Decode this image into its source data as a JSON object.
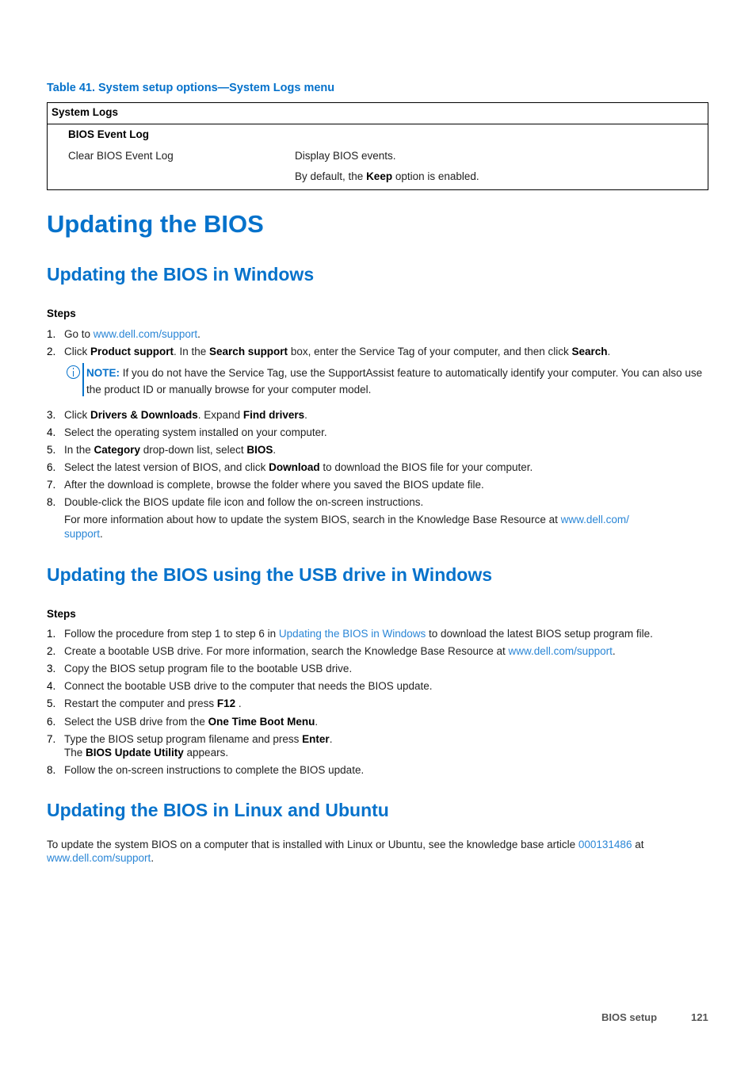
{
  "table": {
    "caption": "Table 41. System setup options—System Logs menu",
    "header": "System Logs",
    "subheader": "BIOS Event Log",
    "option": "Clear BIOS Event Log",
    "desc1": "Display BIOS events.",
    "desc2_pre": "By default, the ",
    "desc2_bold": "Keep",
    "desc2_post": " option is enabled."
  },
  "title": "Updating the BIOS",
  "sec1": {
    "heading": "Updating the BIOS in Windows",
    "steps_label": "Steps",
    "s1": {
      "num": "1.",
      "pre": "Go to ",
      "link": "www.dell.com/support",
      "post": "."
    },
    "s2": {
      "num": "2.",
      "t1": "Click ",
      "b1": "Product support",
      "t2": ". In the ",
      "b2": "Search support",
      "t3": " box, enter the Service Tag of your computer, and then click ",
      "b3": "Search",
      "t4": "."
    },
    "note": {
      "label": "NOTE:",
      "text": " If you do not have the Service Tag, use the SupportAssist feature to automatically identify your computer. You can also use the product ID or manually browse for your computer model."
    },
    "s3": {
      "num": "3.",
      "t1": "Click ",
      "b1": "Drivers & Downloads",
      "t2": ". Expand ",
      "b2": "Find drivers",
      "t3": "."
    },
    "s4": {
      "num": "4.",
      "text": "Select the operating system installed on your computer."
    },
    "s5": {
      "num": "5.",
      "t1": "In the ",
      "b1": "Category",
      "t2": " drop-down list, select ",
      "b2": "BIOS",
      "t3": "."
    },
    "s6": {
      "num": "6.",
      "t1": "Select the latest version of BIOS, and click ",
      "b1": "Download",
      "t2": " to download the BIOS file for your computer."
    },
    "s7": {
      "num": "7.",
      "text": "After the download is complete, browse the folder where you saved the BIOS update file."
    },
    "s8": {
      "num": "8.",
      "text": "Double-click the BIOS update file icon and follow the on-screen instructions."
    },
    "more": {
      "pre": "For more information about how to update the system BIOS, search in the Knowledge Base Resource at ",
      "link1": "www.dell.com/",
      "link2": "support",
      "post": "."
    }
  },
  "sec2": {
    "heading": "Updating the BIOS using the USB drive in Windows",
    "steps_label": "Steps",
    "s1": {
      "num": "1.",
      "pre": "Follow the procedure from step 1 to step 6 in ",
      "link": "Updating the BIOS in Windows",
      "post": " to download the latest BIOS setup program file."
    },
    "s2": {
      "num": "2.",
      "pre": "Create a bootable USB drive. For more information, search the Knowledge Base Resource at ",
      "link": "www.dell.com/support",
      "post": "."
    },
    "s3": {
      "num": "3.",
      "text": "Copy the BIOS setup program file to the bootable USB drive."
    },
    "s4": {
      "num": "4.",
      "text": "Connect the bootable USB drive to the computer that needs the BIOS update."
    },
    "s5": {
      "num": "5.",
      "t1": "Restart the computer and press ",
      "b1": "F12",
      "t2": " ."
    },
    "s6": {
      "num": "6.",
      "t1": "Select the USB drive from the ",
      "b1": "One Time Boot Menu",
      "t2": "."
    },
    "s7": {
      "num": "7.",
      "t1": "Type the BIOS setup program filename and press ",
      "b1": "Enter",
      "t2": ".",
      "l2_t1": "The ",
      "l2_b1": "BIOS Update Utility",
      "l2_t2": " appears."
    },
    "s8": {
      "num": "8.",
      "text": "Follow the on-screen instructions to complete the BIOS update."
    }
  },
  "sec3": {
    "heading": "Updating the BIOS in Linux and Ubuntu",
    "pre": "To update the system BIOS on a computer that is installed with Linux or Ubuntu, see the knowledge base article ",
    "link1": "000131486",
    "mid": " at",
    "link2": "www.dell.com/support",
    "post": "."
  },
  "footer": {
    "section": "BIOS setup",
    "page": "121"
  }
}
